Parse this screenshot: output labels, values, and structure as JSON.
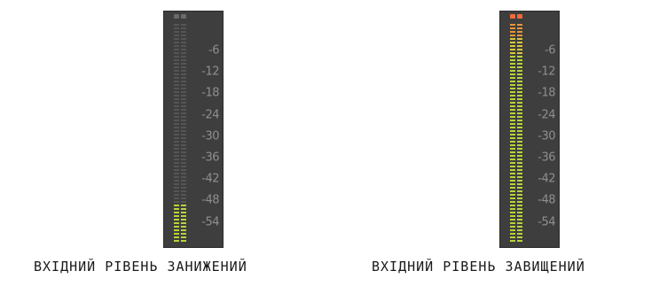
{
  "meters": [
    {
      "caption": "ВХІДНИЙ РІВЕНЬ ЗАНИЖЕНИЙ",
      "level_fraction": 0.17,
      "peak_active": false
    },
    {
      "caption": "ВХІДНИЙ РІВЕНЬ ЗАВИЩЕНИЙ",
      "level_fraction": 1.0,
      "peak_active": true
    }
  ],
  "scale_labels": [
    "-6",
    "-12",
    "-18",
    "-24",
    "-30",
    "-36",
    "-42",
    "-48",
    "-54"
  ],
  "colors": {
    "meter_bg": "#3e3e3e",
    "segment_off": "#555555",
    "segment_green": "#b8d43a",
    "segment_yellow": "#d8c83a",
    "segment_orange": "#e8953a",
    "peak_on": "#f26a3a",
    "peak_off": "#6a6a6a",
    "scale_text": "#8f8f8f"
  }
}
